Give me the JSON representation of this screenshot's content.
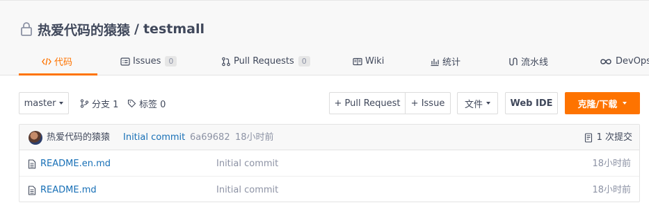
{
  "repo": {
    "owner": "热爱代码的猿猿",
    "separator": "/",
    "name": "testmall"
  },
  "tabs": [
    {
      "label": "代码",
      "icon": "code-icon",
      "active": true
    },
    {
      "label": "Issues",
      "count": "0",
      "icon": "issues-icon"
    },
    {
      "label": "Pull Requests",
      "count": "0",
      "icon": "pull-request-icon"
    },
    {
      "label": "Wiki",
      "icon": "book-icon"
    },
    {
      "label": "统计",
      "icon": "bar-chart-icon"
    },
    {
      "label": "流水线",
      "icon": "pipeline-icon"
    },
    {
      "label": "DevOps",
      "icon": "infinity-icon"
    }
  ],
  "toolbar": {
    "branch": "master",
    "branches_label": "分支 1",
    "tags_label": "标签 0",
    "pull_request_label": "+ Pull Request",
    "issue_label": "+ Issue",
    "file_label": "文件",
    "web_ide_label": "Web IDE",
    "clone_label": "克隆/下载"
  },
  "latest_commit": {
    "author": "热爱代码的猿猿",
    "message": "Initial commit",
    "hash": "6a69682",
    "time": "18小时前",
    "commit_count_label": "1 次提交"
  },
  "files": [
    {
      "name": "README.en.md",
      "message": "Initial commit",
      "time": "18小时前"
    },
    {
      "name": "README.md",
      "message": "Initial commit",
      "time": "18小时前"
    }
  ],
  "colors": {
    "accent": "#fe7300",
    "link": "#176fb6",
    "muted": "#8c92a4",
    "text": "#40485b"
  }
}
